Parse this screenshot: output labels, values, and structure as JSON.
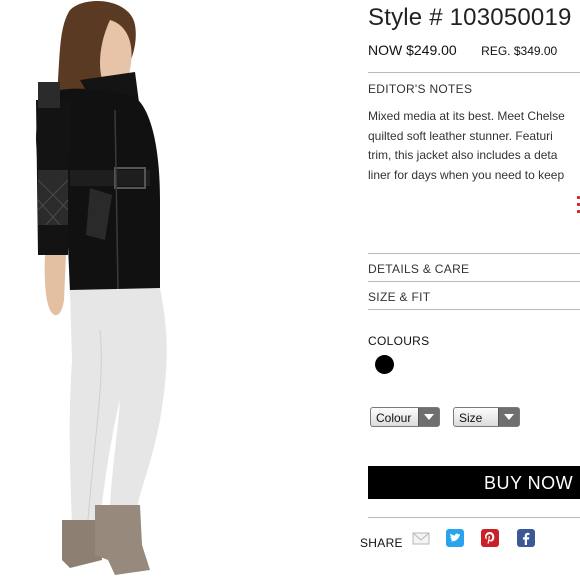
{
  "product": {
    "title": "Style # 103050019",
    "now_price": "NOW $249.00",
    "reg_price": "REG. $349.00",
    "image_alt": "model-wearing-black-belted-jacket"
  },
  "editor_notes": {
    "heading": "EDITOR'S NOTES",
    "lines": [
      "Mixed media at its best. Meet Chelse",
      "quilted soft leather stunner. Featuri",
      "trim, this jacket also includes a deta",
      "liner for days when you need to keep"
    ]
  },
  "accordion": {
    "details_label": "DETAILS & CARE",
    "size_label": "SIZE & FIT"
  },
  "colours": {
    "heading": "COLOURS",
    "swatches": [
      {
        "name": "black",
        "hex": "#000000"
      }
    ]
  },
  "selects": {
    "colour_label": "Colour",
    "size_label": "Size"
  },
  "buy": {
    "label": "BUY NOW"
  },
  "share": {
    "label": "SHARE",
    "icons": [
      "email-icon",
      "twitter-icon",
      "pinterest-icon",
      "facebook-icon"
    ]
  },
  "colors": {
    "twitter": "#2aa3ef",
    "pinterest": "#cb2027",
    "facebook": "#3b5998",
    "buy_bg": "#000000"
  }
}
